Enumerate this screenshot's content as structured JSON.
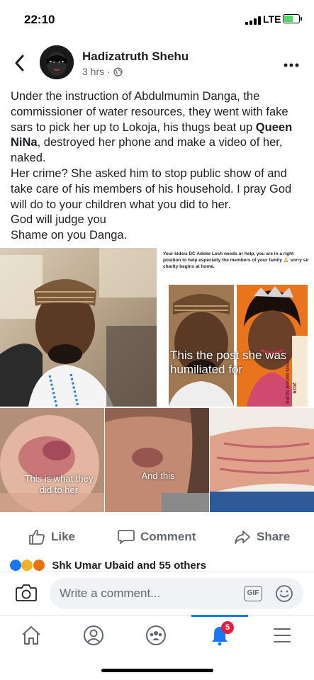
{
  "status_bar": {
    "time": "22:10",
    "network": "LTE",
    "battery_level": 0.6,
    "battery_color": "#4cd964"
  },
  "post": {
    "back_icon": "chevron-left-icon",
    "author": "Hadizatruth Shehu",
    "time_ago": "3 hrs ·",
    "privacy_icon": "globe-icon",
    "more_icon": "more-dots-icon",
    "text_part1": "Under the instruction of Abdulmumin Danga, the commissioner of water resources, they went with fake sars to pick her up to Lokoja, his thugs beat up ",
    "text_bold": "Queen NiNa",
    "text_part2": ", destroyed her phone and make a video of her, naked.\nHer crime? She asked him to stop public show of and take care of his members of his household. I pray God will do to your children what you did to her.\nGod will judge you\nShame on you Danga."
  },
  "photos": {
    "screenshot_text": "Your kidsis  DC Adoke Lesh needs ur help, you are in a right position to help especially the members of your family 🙏 sorry sir charity begins at home.",
    "caption_post": "This the post she was humiliated for",
    "caption_injury": "This is what they did to her",
    "caption_and_this": "And this",
    "banner_text": "QUEEN NIGER NUPE",
    "banner_year": "2019"
  },
  "actions": {
    "like_label": "Like",
    "comment_label": "Comment",
    "share_label": "Share",
    "like_icon": "thumbs-up-icon",
    "comment_icon": "speech-bubble-icon",
    "share_icon": "share-arrow-icon"
  },
  "reactions": {
    "text": "Shk Umar Ubaid and 55 others"
  },
  "comment_bar": {
    "placeholder": "Write a comment...",
    "camera_icon": "camera-icon",
    "gif_label": "GIF",
    "emoji_icon": "smiley-icon"
  },
  "nav": {
    "home_icon": "home-icon",
    "profile_icon": "profile-icon",
    "groups_icon": "groups-icon",
    "notifications_icon": "bell-icon",
    "notifications_badge": "5",
    "menu_icon": "menu-icon",
    "accent_color": "#1877f2"
  }
}
